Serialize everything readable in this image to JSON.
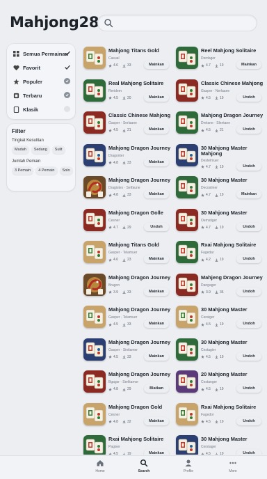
{
  "app": {
    "title": "Mahjong288"
  },
  "search": {
    "placeholder": "",
    "value": ""
  },
  "nav": [
    {
      "label": "Semua Permainan",
      "icon": "grid-icon",
      "state": "check"
    },
    {
      "label": "Favorit",
      "icon": "heart-icon",
      "state": "check"
    },
    {
      "label": "Populer",
      "icon": "star-icon",
      "state": "dot"
    },
    {
      "label": "Terbaru",
      "icon": "clock-icon",
      "state": "dot"
    },
    {
      "label": "Klasik",
      "icon": "tile-icon",
      "state": "off"
    }
  ],
  "filter": {
    "title": "Filter",
    "difficulty_label": "Tingkat Kesulitan",
    "difficulty": [
      "Mudah",
      "Sedang",
      "Sulit"
    ],
    "mode_label": "Jumlah Pemain",
    "modes": [
      "3 Pemain",
      "4 Pemain",
      "Solo"
    ]
  },
  "games": [
    {
      "title": "Mahjong Titans Gold",
      "sub": "Casual",
      "rating": "4.6",
      "plays": "33",
      "button": "Mainkan",
      "art": "tiles-cream"
    },
    {
      "title": "Reel Mahjong Solitaire",
      "sub": "Derdager",
      "rating": "4.7",
      "plays": "19",
      "button": "Mainkan",
      "art": "tiles-green"
    },
    {
      "title": "Real Mahjong Solitaire",
      "sub": "Reridem",
      "rating": "4.5",
      "plays": "20",
      "button": "Mainkan",
      "art": "tiles-green"
    },
    {
      "title": "Classic Chinese Mahjong",
      "sub": "Gasper · Nerlaane",
      "rating": "4.5",
      "plays": "19",
      "button": "Undoh",
      "art": "tiles-red"
    },
    {
      "title": "Classic Chinese Mahjong",
      "sub": "Gasper · Serlaane",
      "rating": "4.5",
      "plays": "21",
      "button": "Mainkan",
      "art": "tiles-red"
    },
    {
      "title": "Mahjong Dragon Journey",
      "sub": "Dretane · Slentane",
      "rating": "4.5",
      "plays": "21",
      "button": "Undoh",
      "art": "tiles-green"
    },
    {
      "title": "Mahjong Dragon Journey",
      "sub": "Dragonter",
      "rating": "4.8",
      "plays": "33",
      "button": "Mainkan",
      "art": "tiles-blue"
    },
    {
      "title": "30 Mahjong Master Mahjong",
      "sub": "Destelmuer",
      "rating": "4.7",
      "plays": "19",
      "button": "Undoh",
      "art": "tiles-blue"
    },
    {
      "title": "Mahjong Dragon Journey",
      "sub": "Dragistex · Setfaune",
      "rating": "4.8",
      "plays": "33",
      "button": "Mainkan",
      "art": "dragon"
    },
    {
      "title": "30 Mahjong Master",
      "sub": "Decostiner",
      "rating": "4.7",
      "plays": "19",
      "button": "Mainkan",
      "art": "tiles-green"
    },
    {
      "title": "Mahjong Dragon Golle",
      "sub": "Cesner",
      "rating": "4.7",
      "plays": "29",
      "button": "Undoh",
      "art": "tiles-red"
    },
    {
      "title": "30 Mahjong Master",
      "sub": "Oemstiger",
      "rating": "4.7",
      "plays": "19",
      "button": "Undoh",
      "art": "tiles-red"
    },
    {
      "title": "Mahjong Titans Gold",
      "sub": "Gasper · Telamuer",
      "rating": "4.6",
      "plays": "23",
      "button": "Mainkan",
      "art": "tiles-cream"
    },
    {
      "title": "Rxai Mahjong Solitaire",
      "sub": "Fagedar",
      "rating": "4.2",
      "plays": "19",
      "button": "Undoh",
      "art": "tiles-green"
    },
    {
      "title": "Mahjong Dragon Journey",
      "sub": "Bragon",
      "rating": "3.9",
      "plays": "33",
      "button": "Mainkan",
      "art": "dragon"
    },
    {
      "title": "Mahjeng Dragon Journey",
      "sub": "Dangager",
      "rating": "3.9",
      "plays": "36",
      "button": "Undoh",
      "art": "tiles-red"
    },
    {
      "title": "Mahjong Dragon Journey",
      "sub": "Gasper · Telamuer",
      "rating": "4.5",
      "plays": "33",
      "button": "Mainkan",
      "art": "tiles-cream"
    },
    {
      "title": "30 Mahjong Master",
      "sub": "Ceratger",
      "rating": "4.5",
      "plays": "19",
      "button": "Undoh",
      "art": "tiles-cream"
    },
    {
      "title": "Mahjong Dragon Journey",
      "sub": "Gasper · Sintiamer",
      "rating": "4.5",
      "plays": "33",
      "button": "Mainkan",
      "art": "tiles-blue"
    },
    {
      "title": "30 Mahjong Master",
      "sub": "Cestagier",
      "rating": "4.5",
      "plays": "19",
      "button": "Undoh",
      "art": "tiles-green"
    },
    {
      "title": "Mahjong Dragon Journey",
      "sub": "Bgagsr · Serlitamor",
      "rating": "4.8",
      "plays": "29",
      "button": "Blatkan",
      "art": "tiles-red"
    },
    {
      "title": "20 Mahjong Master",
      "sub": "Cestanger",
      "rating": "4.5",
      "plays": "19",
      "button": "Undoh",
      "art": "tiles-purple"
    },
    {
      "title": "Mahjong Dragon Gold",
      "sub": "Cesner",
      "rating": "4.8",
      "plays": "32",
      "button": "Mainkan",
      "art": "tiles-cream"
    },
    {
      "title": "Rxai Mahjong Solitaire",
      "sub": "Fagedor",
      "rating": "4.5",
      "plays": "19",
      "button": "Undoh",
      "art": "tiles-cream"
    },
    {
      "title": "Rxai Mahjong Solitaire",
      "sub": "Pagiser",
      "rating": "4.5",
      "plays": "19",
      "button": "Mainkan",
      "art": "tiles-green"
    },
    {
      "title": "30 Mahjong Master",
      "sub": "Cerstager",
      "rating": "4.5",
      "plays": "19",
      "button": "Undoh",
      "art": "tiles-blue"
    }
  ],
  "tabs": [
    {
      "label": "Home",
      "icon": "home-icon",
      "active": false
    },
    {
      "label": "Search",
      "icon": "search-icon",
      "active": true
    },
    {
      "label": "Profile",
      "icon": "profile-icon",
      "active": false
    },
    {
      "label": "More",
      "icon": "more-icon",
      "active": false
    }
  ],
  "colors": {
    "background": "#eceef2",
    "card": "#f4f5f8",
    "text": "#1d2229",
    "tile_red": "#c0392b",
    "tile_green": "#2e7d32"
  }
}
